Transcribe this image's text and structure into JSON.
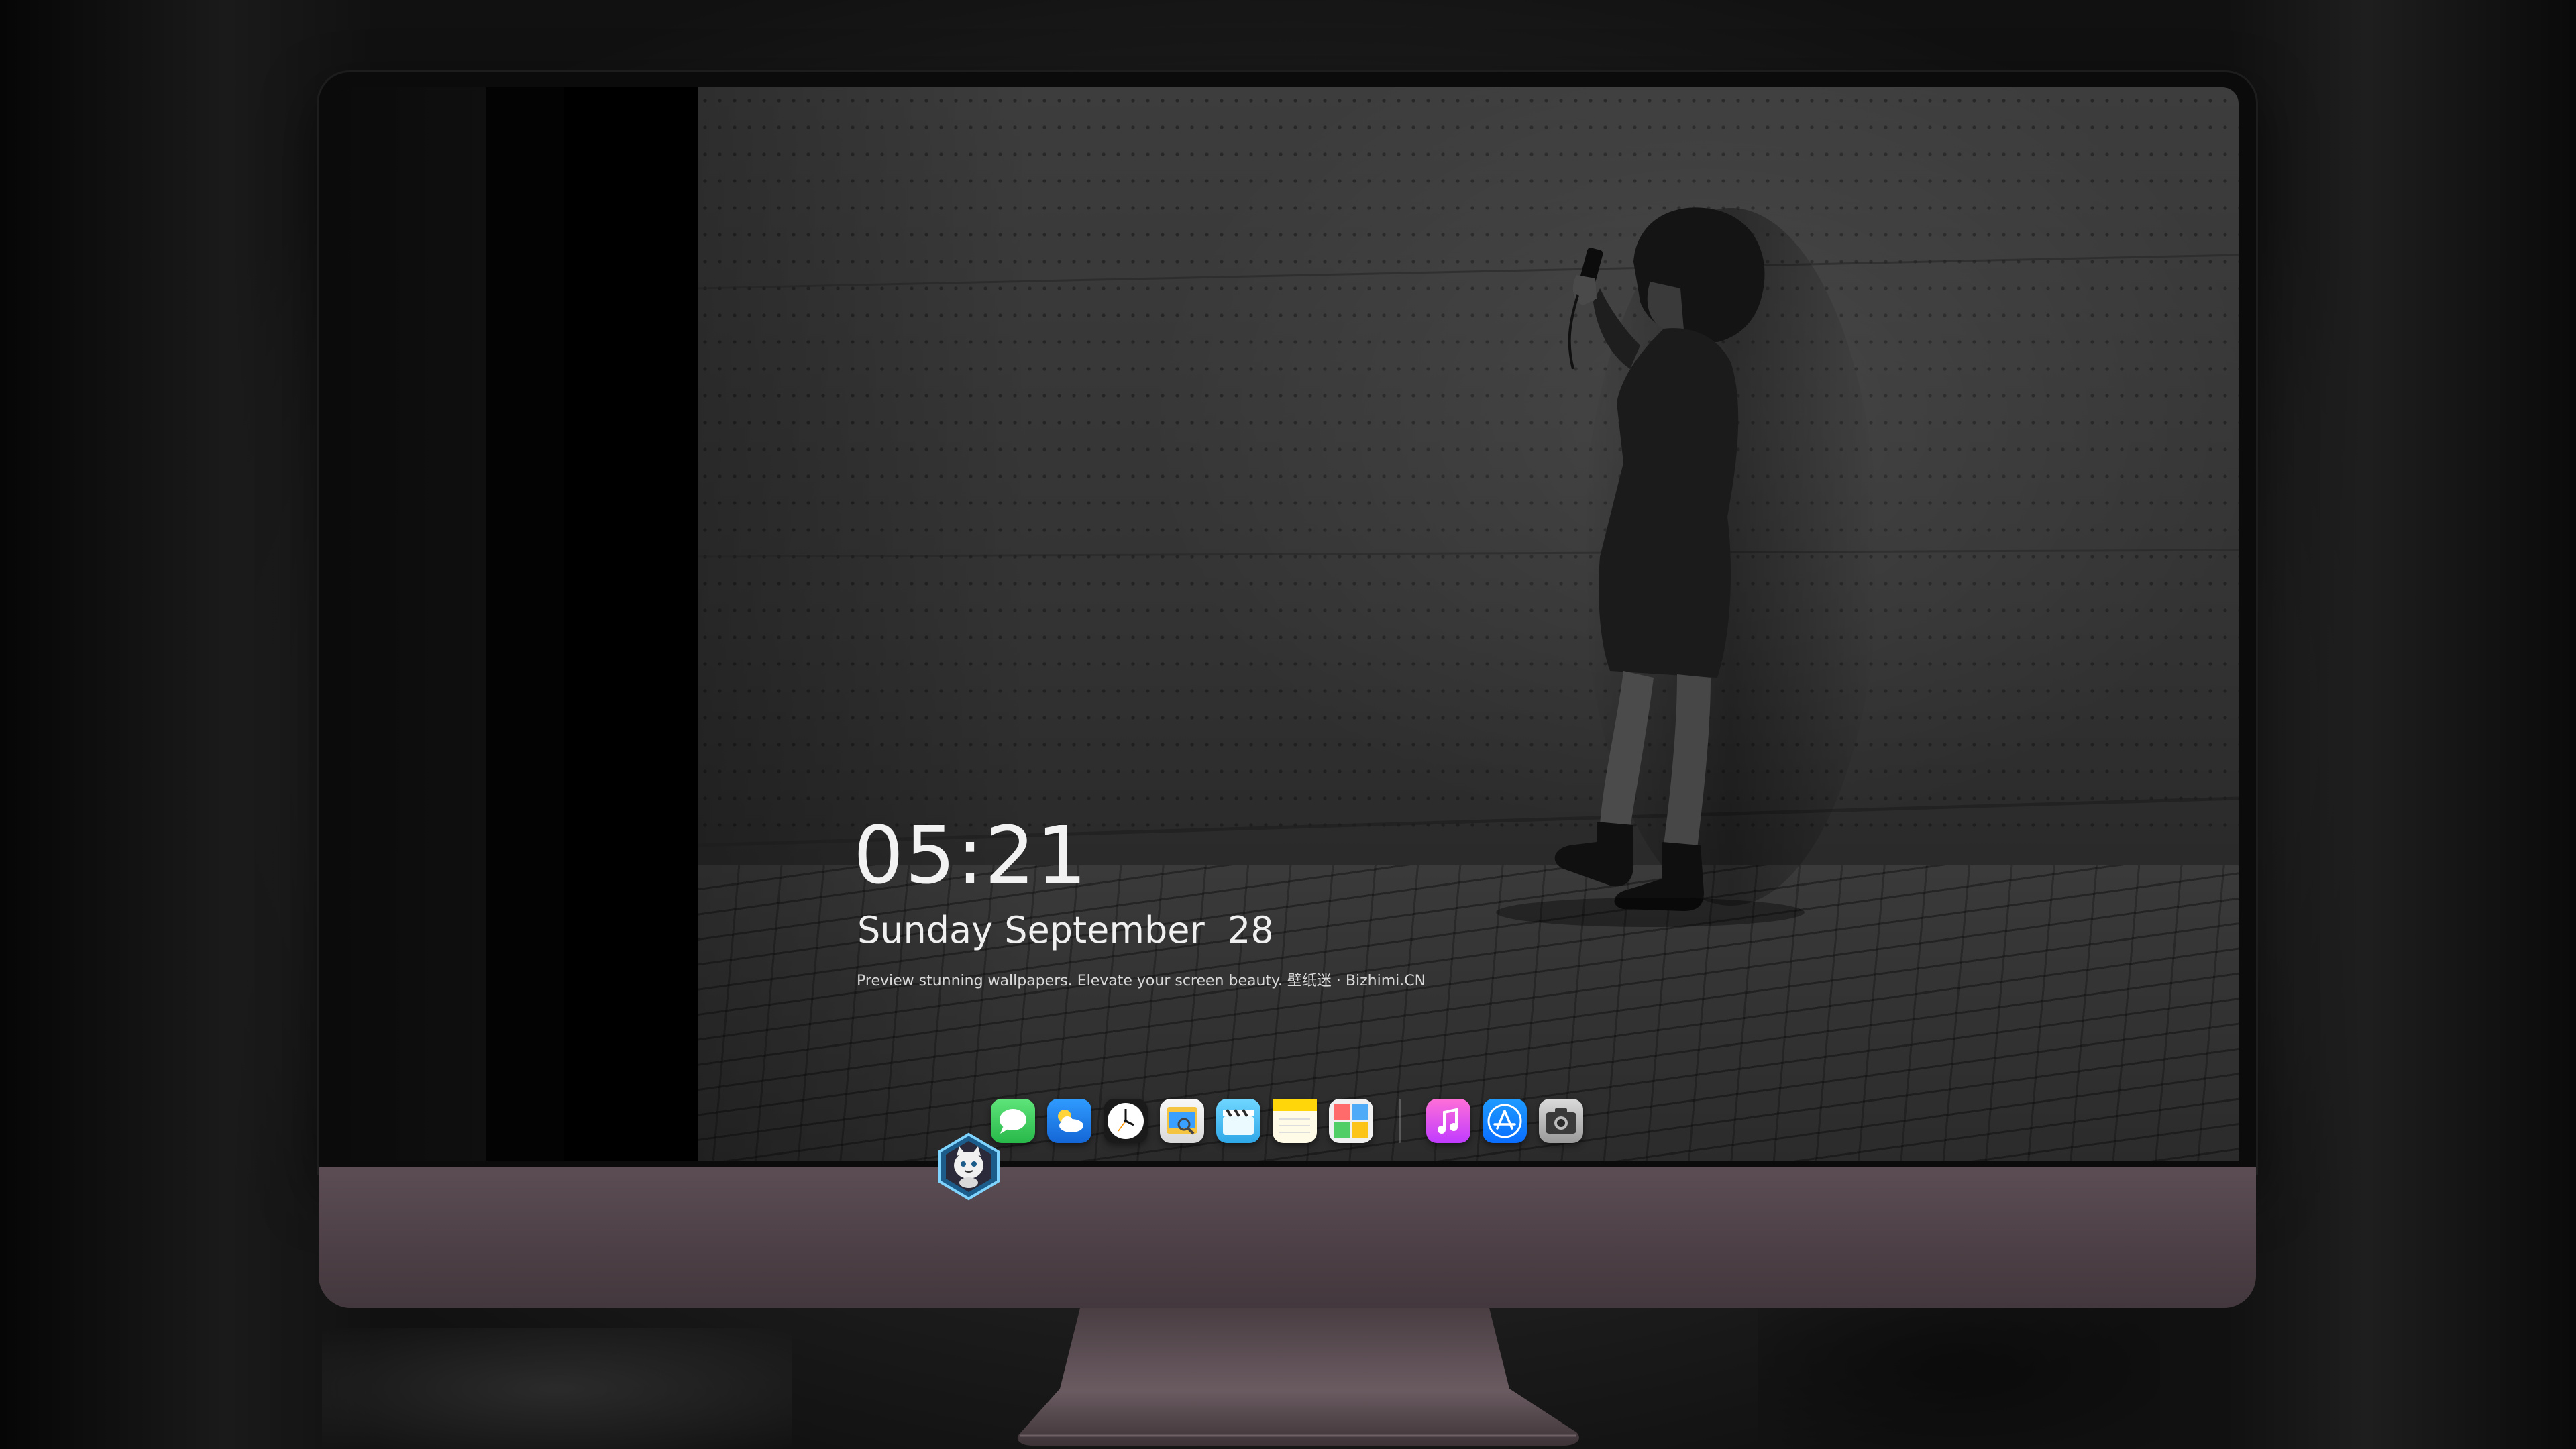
{
  "lockscreen": {
    "time": "05:21",
    "date": "Sunday September  28",
    "tagline": "Preview stunning wallpapers. Elevate your screen beauty. 壁纸迷 · Bizhimi.CN"
  },
  "dock": {
    "apps": [
      {
        "name": "Messages",
        "icon": "messages-icon",
        "color": "#34c759"
      },
      {
        "name": "Weather",
        "icon": "weather-icon",
        "color": "#1e90ff"
      },
      {
        "name": "Clock",
        "icon": "clock-icon",
        "color": "#1c1c1c"
      },
      {
        "name": "Preview",
        "icon": "preview-icon",
        "color": "#f5c542"
      },
      {
        "name": "Clips",
        "icon": "clips-icon",
        "color": "#5ac8fa"
      },
      {
        "name": "Notes",
        "icon": "notes-icon",
        "color": "#ffd60a"
      },
      {
        "name": "Photo Booth",
        "icon": "photo-booth-icon",
        "color": "#e8e8e8"
      },
      {
        "name": "Music",
        "icon": "music-icon",
        "color": "#fc3c8d"
      },
      {
        "name": "App Store",
        "icon": "app-store-icon",
        "color": "#0a84ff"
      },
      {
        "name": "Camera",
        "icon": "camera-icon",
        "color": "#8e8e93"
      }
    ]
  },
  "colors": {
    "chin": "#4d4046",
    "bezel": "#0b0b0b",
    "text": "#f2f2f2"
  }
}
